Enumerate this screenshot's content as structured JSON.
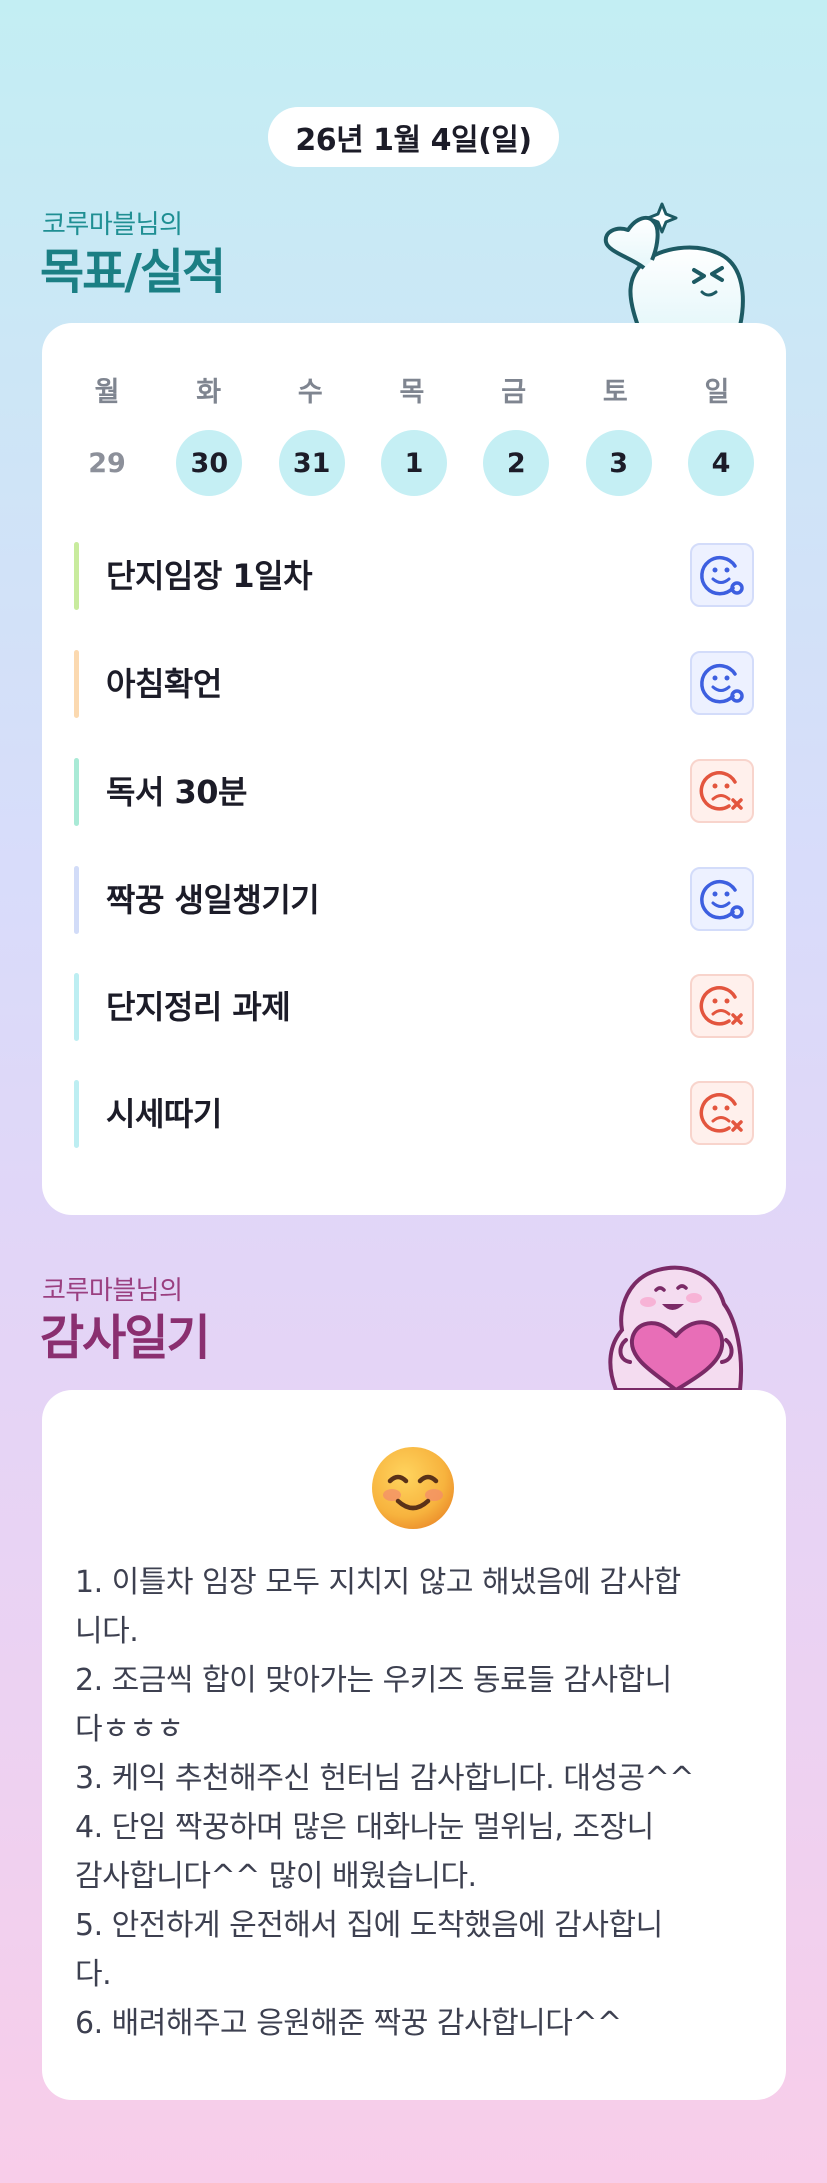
{
  "header": {
    "date": "26년 1월 4일(일)"
  },
  "goals_section": {
    "subtitle": "코루마블님의",
    "title": "목표/실적"
  },
  "week": {
    "days": [
      "월",
      "화",
      "수",
      "목",
      "금",
      "토",
      "일"
    ],
    "dates": [
      {
        "num": "29",
        "active": false
      },
      {
        "num": "30",
        "active": true
      },
      {
        "num": "31",
        "active": true
      },
      {
        "num": "1",
        "active": true
      },
      {
        "num": "2",
        "active": true
      },
      {
        "num": "3",
        "active": true
      },
      {
        "num": "4",
        "active": true
      }
    ]
  },
  "goals": [
    {
      "label": "단지임장 1일차",
      "bar_color": "#c8eb9d",
      "status": "success"
    },
    {
      "label": "아침확언",
      "bar_color": "#fbd9b0",
      "status": "success"
    },
    {
      "label": "독서 30분",
      "bar_color": "#a9ead6",
      "status": "fail"
    },
    {
      "label": "짝꿍 생일챙기기",
      "bar_color": "#d2dcf8",
      "status": "success"
    },
    {
      "label": "단지정리 과제",
      "bar_color": "#bdeef2",
      "status": "fail"
    },
    {
      "label": "시세따기",
      "bar_color": "#bdeef2",
      "status": "fail"
    }
  ],
  "gratitude_section": {
    "subtitle": "코루마블님의",
    "title": "감사일기",
    "emoji": "😊"
  },
  "gratitude_lines": [
    "1. 이틀차 임장 모두 지치지 않고 해냈음에 감사합",
    "니다.",
    "2. 조금씩 합이 맞아가는 우키즈 동료들 감사합니",
    "다ㅎㅎㅎ",
    "3. 케익 추천해주신 헌터님 감사합니다. 대성공^^",
    "4. 단임 짝꿍하며 많은 대화나눈 멀위님, 조장니",
    "감사합니다^^ 많이 배웠습니다.",
    "5. 안전하게 운전해서 집에 도착했음에 감사합니",
    "다.",
    "6. 배려해주고 응원해준 짝꿍 감사합니다^^"
  ],
  "colors": {
    "success_icon": "#3d5fe0",
    "fail_icon": "#e3553e",
    "teal_title": "#1b7f84",
    "purple_title": "#8a2f70"
  },
  "icons": {
    "success": "smile-check-icon",
    "fail": "frown-x-icon",
    "mascot_top": "mascot-wave-icon",
    "mascot_bottom": "mascot-heart-icon"
  }
}
